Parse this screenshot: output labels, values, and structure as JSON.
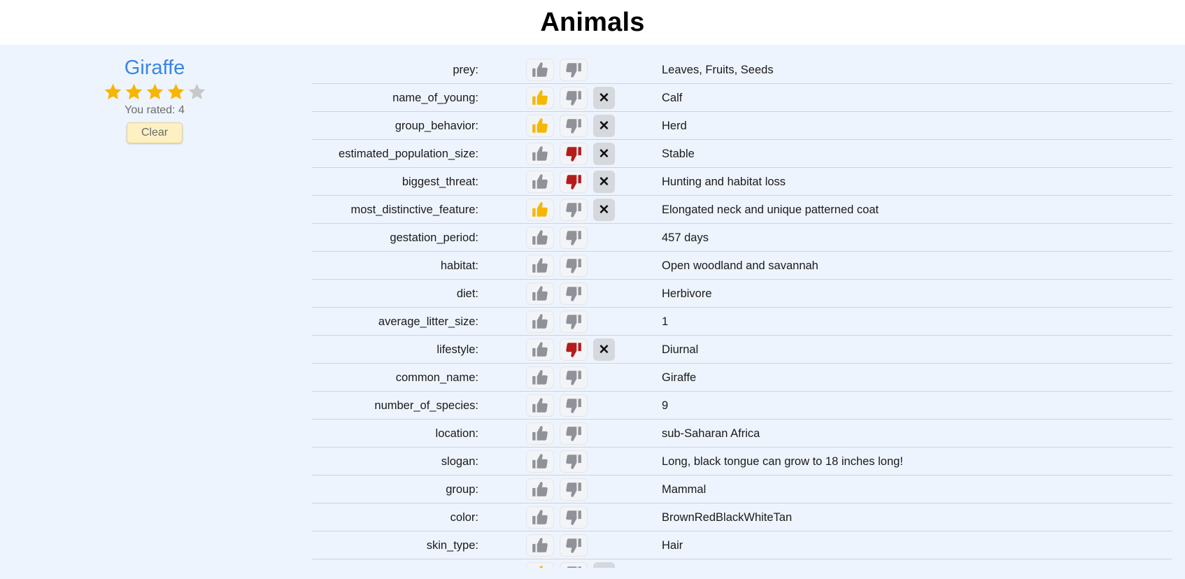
{
  "header": {
    "title": "Animals"
  },
  "animal": {
    "name": "Giraffe",
    "rating": 4,
    "max_rating": 5,
    "rated_text": "You rated: 4",
    "clear_label": "Clear"
  },
  "colors": {
    "star_on": "#f7b500",
    "star_off": "#c8c8c8",
    "thumb_up_on": "#f5b700",
    "thumb_down_on": "#b41c1c",
    "thumb_off": "#8f9299",
    "name_link": "#3a85e6"
  },
  "icons": {
    "up": "thumbs-up-icon",
    "down": "thumbs-down-icon",
    "clear": "close-icon"
  },
  "close_glyph": "✕",
  "rows": [
    {
      "label": "prey:",
      "value": "Leaves, Fruits, Seeds",
      "vote": "none"
    },
    {
      "label": "name_of_young:",
      "value": "Calf",
      "vote": "up"
    },
    {
      "label": "group_behavior:",
      "value": "Herd",
      "vote": "up"
    },
    {
      "label": "estimated_population_size:",
      "value": "Stable",
      "vote": "down"
    },
    {
      "label": "biggest_threat:",
      "value": "Hunting and habitat loss",
      "vote": "down"
    },
    {
      "label": "most_distinctive_feature:",
      "value": "Elongated neck and unique patterned coat",
      "vote": "up"
    },
    {
      "label": "gestation_period:",
      "value": "457 days",
      "vote": "none"
    },
    {
      "label": "habitat:",
      "value": "Open woodland and savannah",
      "vote": "none"
    },
    {
      "label": "diet:",
      "value": "Herbivore",
      "vote": "none"
    },
    {
      "label": "average_litter_size:",
      "value": "1",
      "vote": "none"
    },
    {
      "label": "lifestyle:",
      "value": "Diurnal",
      "vote": "down"
    },
    {
      "label": "common_name:",
      "value": "Giraffe",
      "vote": "none"
    },
    {
      "label": "number_of_species:",
      "value": "9",
      "vote": "none"
    },
    {
      "label": "location:",
      "value": "sub-Saharan Africa",
      "vote": "none"
    },
    {
      "label": "slogan:",
      "value": "Long, black tongue can grow to 18 inches long!",
      "vote": "none"
    },
    {
      "label": "group:",
      "value": "Mammal",
      "vote": "none"
    },
    {
      "label": "color:",
      "value": "BrownRedBlackWhiteTan",
      "vote": "none"
    },
    {
      "label": "skin_type:",
      "value": "Hair",
      "vote": "none"
    },
    {
      "label": "",
      "value": "",
      "vote": "up"
    }
  ]
}
